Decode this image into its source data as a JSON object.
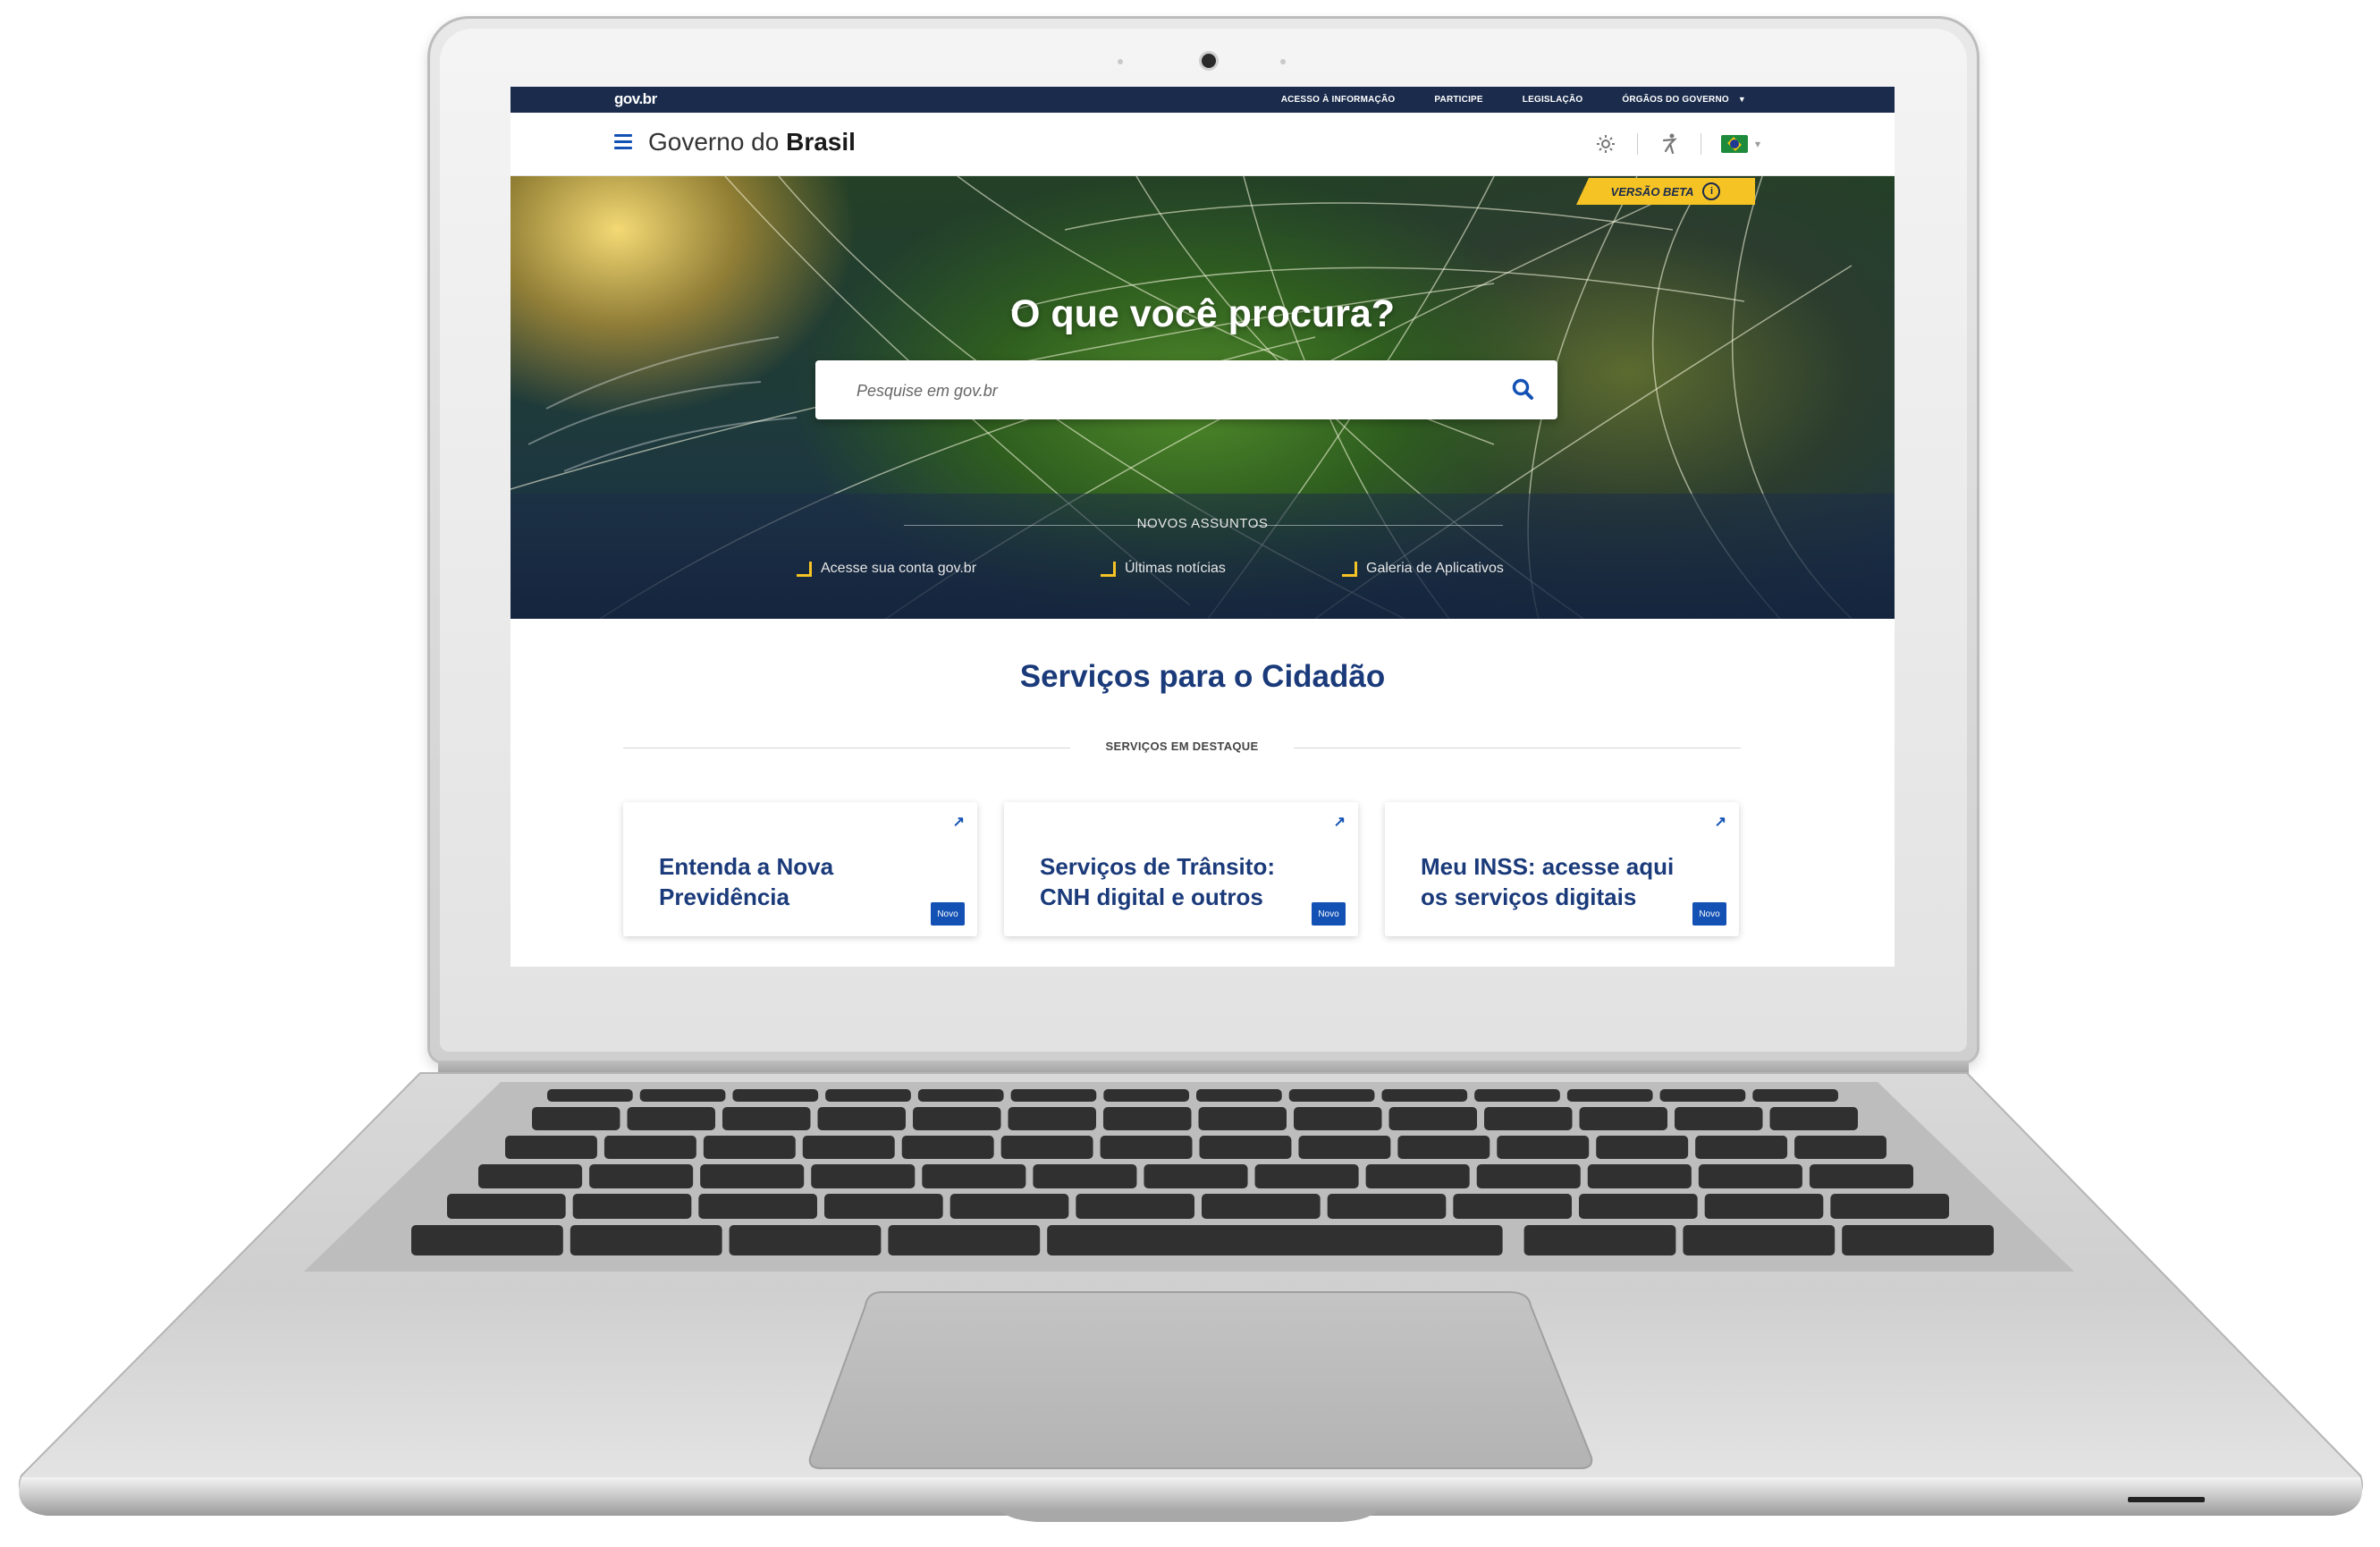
{
  "topbar": {
    "logo": "gov.br",
    "links": [
      {
        "label": "ACESSO À INFORMAÇÃO"
      },
      {
        "label": "PARTICIPE"
      },
      {
        "label": "LEGISLAÇÃO"
      },
      {
        "label": "ÓRGÃOS DO GOVERNO"
      }
    ]
  },
  "header": {
    "title_prefix": "Governo do ",
    "title_bold": "Brasil",
    "icons": [
      "contrast-icon",
      "accessibility-icon",
      "brazil-flag-icon"
    ]
  },
  "hero": {
    "beta_label": "VERSÃO BETA",
    "title": "O que você procura?",
    "search_placeholder": "Pesquise em gov.br",
    "novos_label": "NOVOS ASSUNTOS",
    "quick_links": [
      {
        "label": "Acesse sua conta gov.br"
      },
      {
        "label": "Últimas notícias"
      },
      {
        "label": "Galeria de Aplicativos"
      }
    ]
  },
  "services": {
    "title": "Serviços para o Cidadão",
    "subtitle": "SERVIÇOS EM DESTAQUE",
    "cards": [
      {
        "title": "Entenda a Nova Previdência",
        "badge": "Novo"
      },
      {
        "title": "Serviços de Trânsito: CNH digital e outros",
        "badge": "Novo"
      },
      {
        "title": "Meu INSS: acesse aqui os serviços digitais",
        "badge": "Novo"
      }
    ]
  },
  "colors": {
    "topbar": "#1a2b4c",
    "primary_blue": "#1351b4",
    "heading_blue": "#1a3a7a",
    "beta_yellow": "#f6c324"
  }
}
